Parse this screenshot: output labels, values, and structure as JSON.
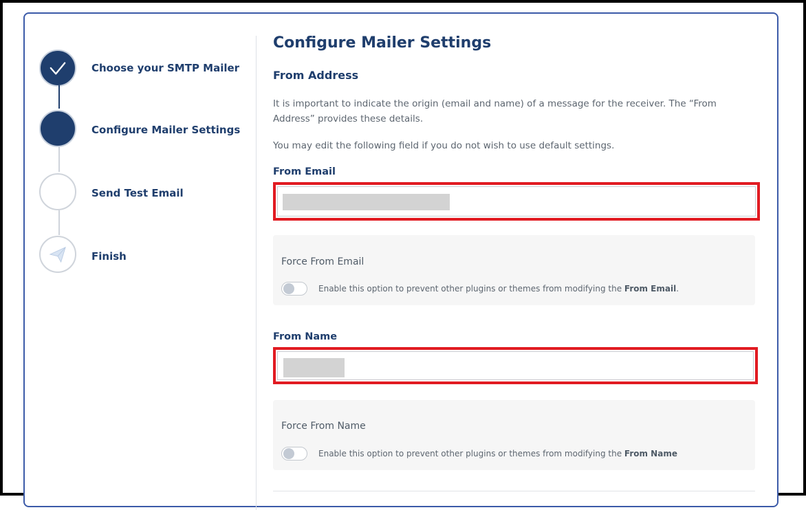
{
  "steps": [
    {
      "label": "Choose your SMTP Mailer",
      "state": "done",
      "icon": "check-icon"
    },
    {
      "label": "Configure Mailer Settings",
      "state": "current",
      "icon": ""
    },
    {
      "label": "Send Test Email",
      "state": "todo",
      "icon": ""
    },
    {
      "label": "Finish",
      "state": "todo",
      "icon": "paper-plane-icon"
    }
  ],
  "main": {
    "title": "Configure Mailer Settings",
    "section_title": "From Address",
    "desc1": "It is important to indicate the origin (email and name) of a message for the receiver. The “From Address” provides these details.",
    "desc2": "You may edit the following field if you do not wish to use default settings.",
    "from_email": {
      "label": "From Email",
      "value": ""
    },
    "force_from_email": {
      "title": "Force From Email",
      "toggle_text": "Enable this option to prevent other plugins or themes from modifying the ",
      "toggle_bold": "From Email",
      "toggle_suffix": ".",
      "enabled": false
    },
    "from_name": {
      "label": "From Name",
      "value": ""
    },
    "force_from_name": {
      "title": "Force From Name",
      "toggle_text": "Enable this option to prevent other plugins or themes from modifying the ",
      "toggle_bold": "From Name",
      "toggle_suffix": "",
      "enabled": false
    }
  },
  "colors": {
    "accent": "#1f3e6d",
    "highlight": "#e11b22",
    "card_border": "#3b5aa8"
  }
}
